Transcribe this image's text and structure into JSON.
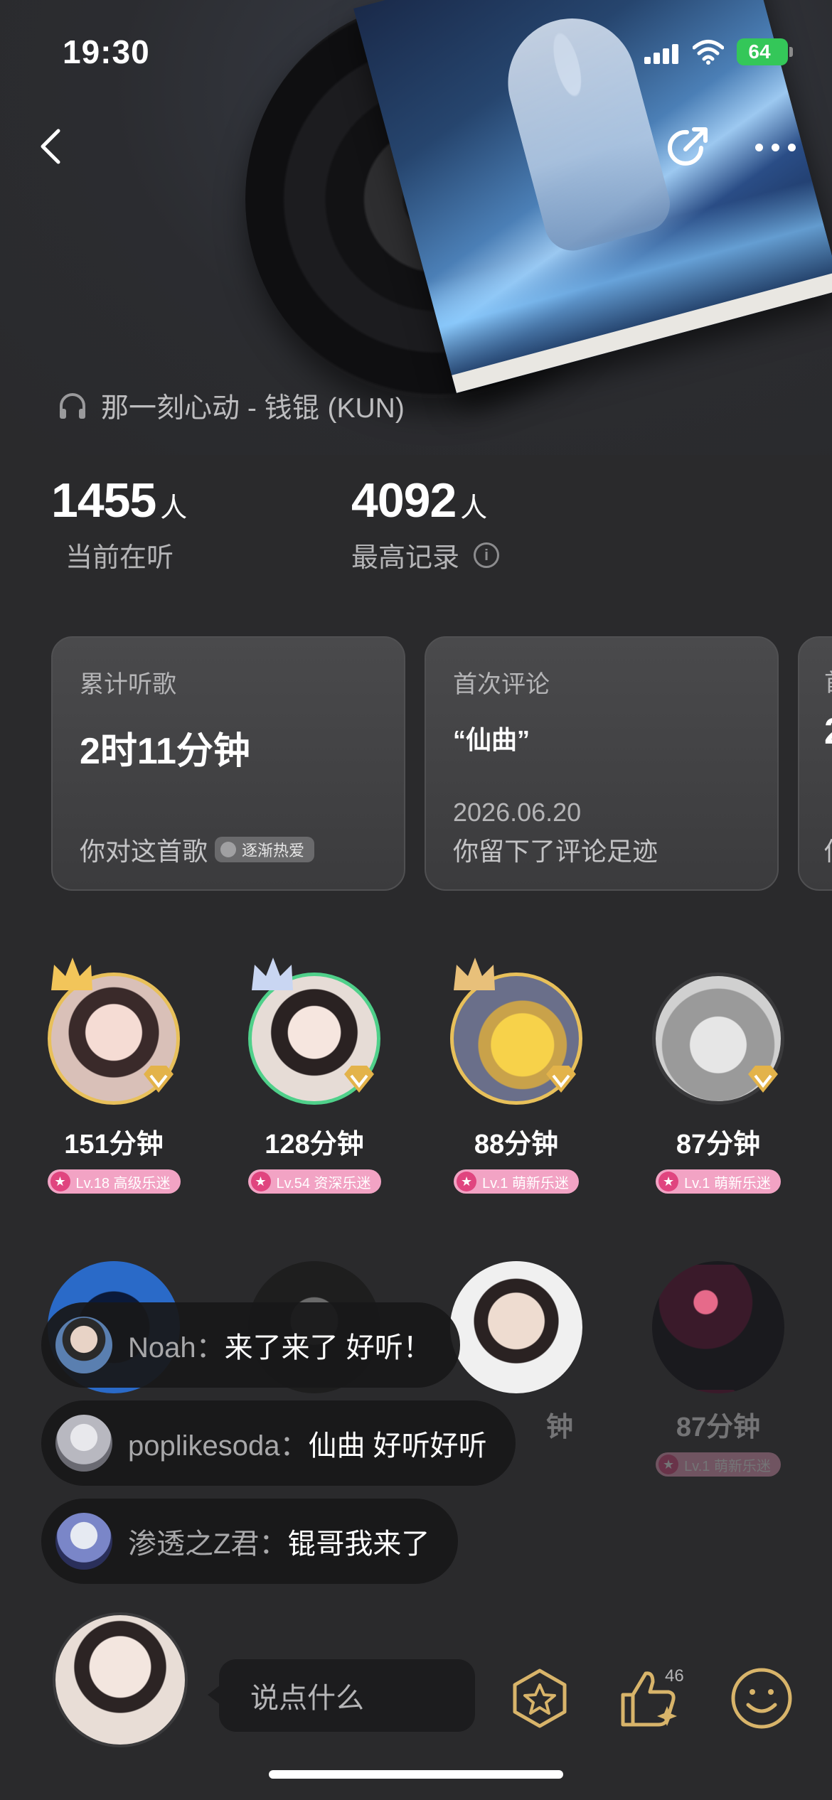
{
  "status_bar": {
    "time": "19:30",
    "battery": "64"
  },
  "song": {
    "title": "那一刻心动 - 钱锟 (KUN)"
  },
  "stats": [
    {
      "number": "1455",
      "unit": "人",
      "label": "当前在听"
    },
    {
      "number": "4092",
      "unit": "人",
      "label": "最高记录"
    }
  ],
  "cards": {
    "total": {
      "title": "累计听歌",
      "value": "2时11分钟",
      "footer": "你对这首歌",
      "tag": "逐渐热爱"
    },
    "first_comment": {
      "title": "首次评论",
      "quote": "“仙曲”",
      "date": "2026.06.20",
      "footer": "你留下了评论足迹"
    },
    "peek": {
      "title": "首",
      "value": "2",
      "footer": "你"
    }
  },
  "listeners": [
    {
      "minutes": "151分钟",
      "level": "Lv.18 高级乐迷",
      "ring": "#e8c05a"
    },
    {
      "minutes": "128分钟",
      "level": "Lv.54 资深乐迷",
      "ring": "#4fd08a"
    },
    {
      "minutes": "88分钟",
      "level": "Lv.1 萌新乐迷",
      "ring": "#e8c05a"
    },
    {
      "minutes": "87分钟",
      "level": "Lv.1 萌新乐迷",
      "ring": "#3a3a3c"
    }
  ],
  "listeners_row2": [
    {
      "minutes": "钟"
    },
    {
      "minutes": "87分钟",
      "level": "Lv.1 萌新乐迷"
    }
  ],
  "comments": [
    {
      "user": "Noah：",
      "text": "来了来了 好听！"
    },
    {
      "user": "poplikesoda：",
      "text": "仙曲 好听好听"
    },
    {
      "user": "渗透之Z君：",
      "text": "锟哥我来了"
    }
  ],
  "bottom": {
    "input_placeholder": "说点什么",
    "like_count": "46"
  },
  "colors": {
    "background": "#2a2a2c",
    "accent_pink": "#e0457f",
    "battery_green": "#34c759"
  }
}
